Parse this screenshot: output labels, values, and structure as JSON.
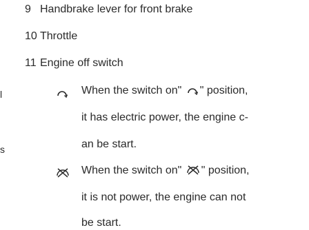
{
  "items": [
    {
      "number": "9",
      "text": "Handbrake lever for front brake"
    },
    {
      "number": "10",
      "text": "Throttle"
    },
    {
      "number": "11",
      "text": "Engine off switch"
    }
  ],
  "switch_on": {
    "icon": "switch-on-arc-icon",
    "line1_before": "When the switch on\"",
    "line1_after": "\" position,",
    "line2": "it has electric power, the engine c-",
    "line3": "an be start."
  },
  "switch_off": {
    "icon": "switch-off-crossed-icon",
    "line1_before": "When the switch on\"",
    "line1_after": "\" position,",
    "line2": "it is not power, the engine can not",
    "line3": "be start."
  },
  "edge_fragments": [
    "l",
    "s"
  ]
}
